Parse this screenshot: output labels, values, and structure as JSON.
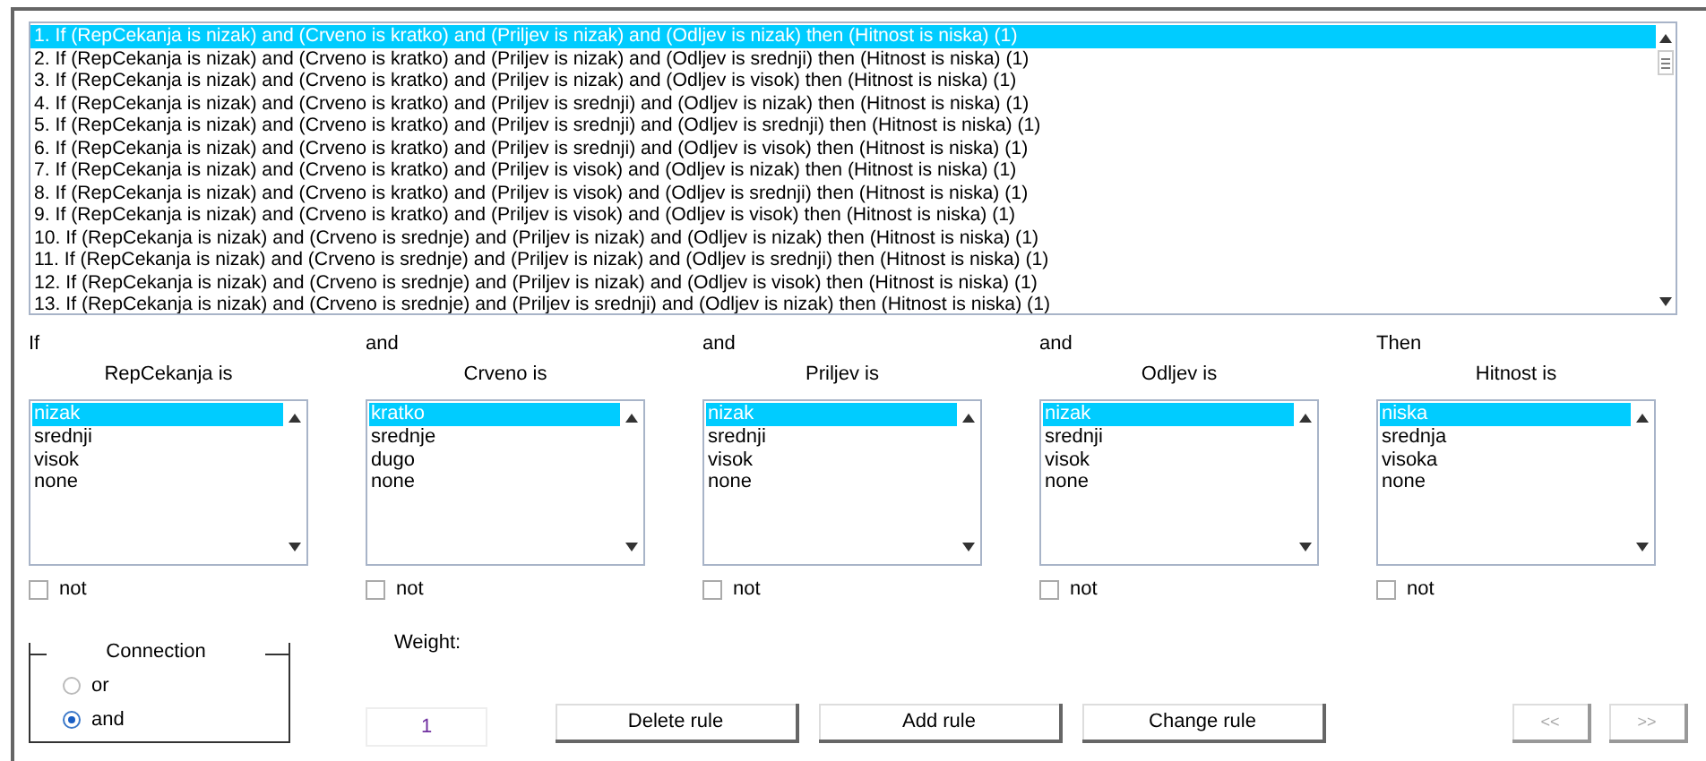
{
  "rules": [
    {
      "text": "1. If (RepCekanja is nizak) and (Crveno is kratko) and (Priljev is nizak) and (Odljev is nizak) then (Hitnost is niska) (1)",
      "selected": true
    },
    {
      "text": "2. If (RepCekanja is nizak) and (Crveno is kratko) and (Priljev is nizak) and (Odljev is srednji) then (Hitnost is niska) (1)",
      "selected": false
    },
    {
      "text": "3. If (RepCekanja is nizak) and (Crveno is kratko) and (Priljev is nizak) and (Odljev is visok) then (Hitnost is niska) (1)",
      "selected": false
    },
    {
      "text": "4. If (RepCekanja is nizak) and (Crveno is kratko) and (Priljev is srednji) and (Odljev is nizak) then (Hitnost is niska) (1)",
      "selected": false
    },
    {
      "text": "5. If (RepCekanja is nizak) and (Crveno is kratko) and (Priljev is srednji) and (Odljev is srednji) then (Hitnost is niska) (1)",
      "selected": false
    },
    {
      "text": "6. If (RepCekanja is nizak) and (Crveno is kratko) and (Priljev is srednji) and (Odljev is visok) then (Hitnost is niska) (1)",
      "selected": false
    },
    {
      "text": "7. If (RepCekanja is nizak) and (Crveno is kratko) and (Priljev is visok) and (Odljev is nizak) then (Hitnost is niska) (1)",
      "selected": false
    },
    {
      "text": "8. If (RepCekanja is nizak) and (Crveno is kratko) and (Priljev is visok) and (Odljev is srednji) then (Hitnost is niska) (1)",
      "selected": false
    },
    {
      "text": "9. If (RepCekanja is nizak) and (Crveno is kratko) and (Priljev is visok) and (Odljev is visok) then (Hitnost is niska) (1)",
      "selected": false
    },
    {
      "text": "10. If (RepCekanja is nizak) and (Crveno is srednje) and (Priljev is nizak) and (Odljev is nizak) then (Hitnost is niska) (1)",
      "selected": false
    },
    {
      "text": "11. If (RepCekanja is nizak) and (Crveno is srednje) and (Priljev is nizak) and (Odljev is srednji) then (Hitnost is niska) (1)",
      "selected": false
    },
    {
      "text": "12. If (RepCekanja is nizak) and (Crveno is srednje) and (Priljev is nizak) and (Odljev is visok) then (Hitnost is niska) (1)",
      "selected": false
    },
    {
      "text": "13. If (RepCekanja is nizak) and (Crveno is srednje) and (Priljev is srednji) and (Odljev is nizak) then (Hitnost is niska) (1)",
      "selected": false
    }
  ],
  "variables": [
    {
      "connective": "If",
      "label": "RepCekanja is",
      "options": [
        {
          "text": "nizak",
          "selected": true
        },
        {
          "text": "srednji",
          "selected": false
        },
        {
          "text": "visok",
          "selected": false
        },
        {
          "text": "none",
          "selected": false
        }
      ],
      "not_label": "not",
      "not_checked": false
    },
    {
      "connective": "and",
      "label": "Crveno is",
      "options": [
        {
          "text": "kratko",
          "selected": true
        },
        {
          "text": "srednje",
          "selected": false
        },
        {
          "text": "dugo",
          "selected": false
        },
        {
          "text": "none",
          "selected": false
        }
      ],
      "not_label": "not",
      "not_checked": false
    },
    {
      "connective": "and",
      "label": "Priljev is",
      "options": [
        {
          "text": "nizak",
          "selected": true
        },
        {
          "text": "srednji",
          "selected": false
        },
        {
          "text": "visok",
          "selected": false
        },
        {
          "text": "none",
          "selected": false
        }
      ],
      "not_label": "not",
      "not_checked": false
    },
    {
      "connective": "and",
      "label": "Odljev is",
      "options": [
        {
          "text": "nizak",
          "selected": true
        },
        {
          "text": "srednji",
          "selected": false
        },
        {
          "text": "visok",
          "selected": false
        },
        {
          "text": "none",
          "selected": false
        }
      ],
      "not_label": "not",
      "not_checked": false
    },
    {
      "connective": "Then",
      "label": "Hitnost is",
      "options": [
        {
          "text": "niska",
          "selected": true
        },
        {
          "text": "srednja",
          "selected": false
        },
        {
          "text": "visoka",
          "selected": false
        },
        {
          "text": "none",
          "selected": false
        }
      ],
      "not_label": "not",
      "not_checked": false
    }
  ],
  "connection": {
    "title": "Connection",
    "options": [
      {
        "label": "or",
        "selected": false
      },
      {
        "label": "and",
        "selected": true
      }
    ]
  },
  "weight": {
    "label": "Weight:",
    "value": "1"
  },
  "buttons": [
    {
      "label": "Delete rule",
      "disabled": false
    },
    {
      "label": "Add rule",
      "disabled": false
    },
    {
      "label": "Change rule",
      "disabled": false
    }
  ],
  "nav_buttons": [
    {
      "label": "<<",
      "disabled": true
    },
    {
      "label": ">>",
      "disabled": true
    }
  ]
}
